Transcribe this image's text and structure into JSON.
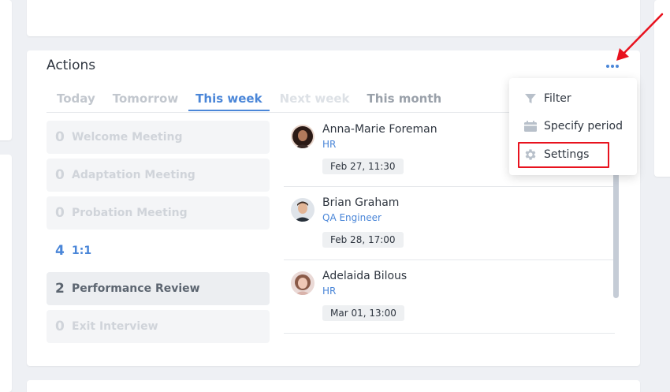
{
  "actions": {
    "title": "Actions",
    "tabs": [
      {
        "label": "Today",
        "state": "muted"
      },
      {
        "label": "Tomorrow",
        "state": "muted"
      },
      {
        "label": "This week",
        "state": "active"
      },
      {
        "label": "Next week",
        "state": "faint"
      },
      {
        "label": "This month",
        "state": "dark"
      }
    ],
    "types": [
      {
        "count": "0",
        "label": "Welcome Meeting",
        "state": "disabled"
      },
      {
        "count": "0",
        "label": "Adaptation Meeting",
        "state": "disabled"
      },
      {
        "count": "0",
        "label": "Probation Meeting",
        "state": "disabled"
      },
      {
        "count": "4",
        "label": "1:1",
        "state": "link"
      },
      {
        "count": "2",
        "label": "Performance Review",
        "state": "selected"
      },
      {
        "count": "0",
        "label": "Exit Interview",
        "state": "disabled"
      }
    ],
    "people": [
      {
        "name": "Anna-Marie Foreman",
        "role": "HR",
        "date": "Feb 27, 11:30"
      },
      {
        "name": "Brian Graham",
        "role": "QA Engineer",
        "date": "Feb 28, 17:00"
      },
      {
        "name": "Adelaida Bilous",
        "role": "HR",
        "date": "Mar 01, 13:00"
      }
    ]
  },
  "menu": {
    "filter": "Filter",
    "specify_period": "Specify period",
    "settings": "Settings"
  },
  "colors": {
    "accent": "#4a86d8",
    "highlight": "#e8121e",
    "arrow": "#e8121e"
  },
  "icons": [
    "more-icon",
    "filter-icon",
    "calendar-icon",
    "gear-icon"
  ]
}
